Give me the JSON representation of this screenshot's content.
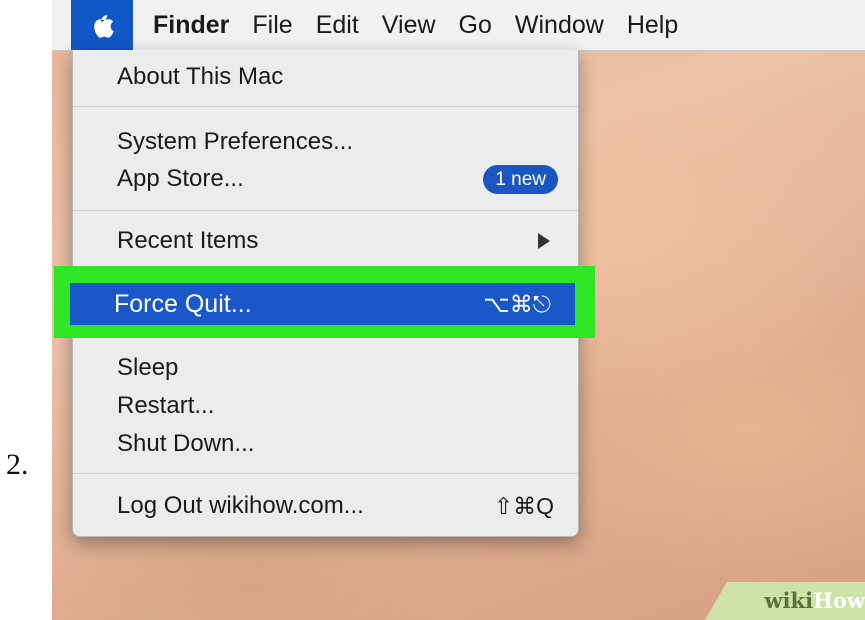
{
  "step_number": "2.",
  "menubar": {
    "apple_icon": "apple-logo",
    "items": [
      "Finder",
      "File",
      "Edit",
      "View",
      "Go",
      "Window",
      "Help"
    ]
  },
  "apple_menu": {
    "about": "About This Mac",
    "system_preferences": "System Preferences...",
    "app_store": "App Store...",
    "app_store_badge": "1 new",
    "recent_items": "Recent Items",
    "force_quit": "Force Quit...",
    "force_quit_shortcut": "⌥⌘⎋",
    "sleep": "Sleep",
    "restart": "Restart...",
    "shut_down": "Shut Down...",
    "log_out": "Log Out wikihow.com...",
    "log_out_shortcut": "⇧⌘Q"
  },
  "highlight_color": "#2ee626",
  "selection_color": "#1a57c9",
  "watermark": {
    "part1": "wiki",
    "part2": "How"
  }
}
